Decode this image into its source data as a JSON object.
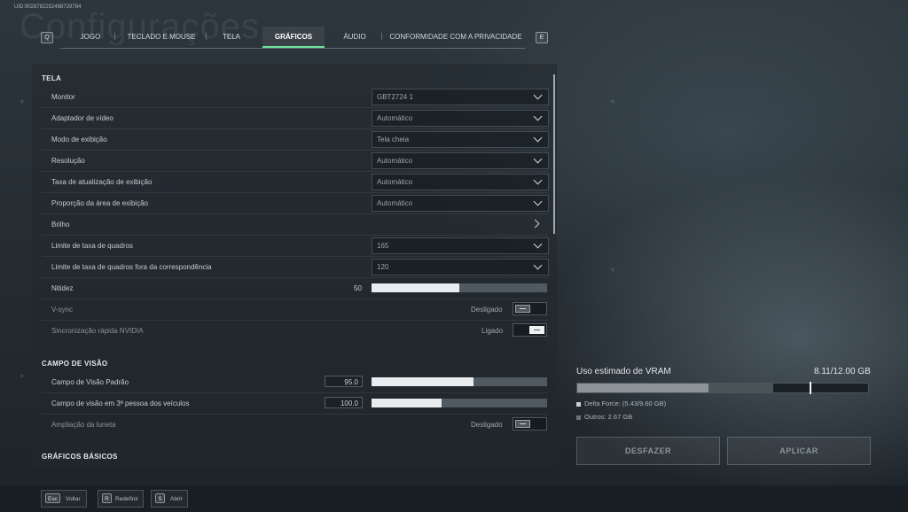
{
  "uid": "UID:9028782252488729784",
  "background_title": "Configurações",
  "tabs": {
    "left_key": "Q",
    "right_key": "E",
    "items": [
      {
        "label": "JOGO"
      },
      {
        "label": "TECLADO E MOUSE"
      },
      {
        "label": "TELA"
      },
      {
        "label": "GRÁFICOS"
      },
      {
        "label": "ÁUDIO"
      },
      {
        "label": "CONFORMIDADE COM A PRIVACIDADE"
      }
    ],
    "active": "GRÁFICOS"
  },
  "sections": {
    "tela": {
      "title": "TELA",
      "monitor": {
        "label": "Monitor",
        "value": "GBT2724 1"
      },
      "video_adapter": {
        "label": "Adaptador de vídeo",
        "value": "Automático"
      },
      "display_mode": {
        "label": "Modo de exibição",
        "value": "Tela cheia"
      },
      "resolution": {
        "label": "Resolução",
        "value": "Automático"
      },
      "refresh_rate": {
        "label": "Taxa de atualização de exibição",
        "value": "Automático"
      },
      "aspect_ratio": {
        "label": "Proporção da área de exibição",
        "value": "Automático"
      },
      "brightness": {
        "label": "Brilho"
      },
      "fps_limit": {
        "label": "Limite de taxa de quadros",
        "value": "165"
      },
      "fps_limit_unfocused": {
        "label": "Limite de taxa de quadros fora da correspondência",
        "value": "120"
      },
      "sharpness": {
        "label": "Nitidez",
        "value": "50",
        "level_percent": 50
      },
      "vsync": {
        "label": "V-sync",
        "state": "Desligado",
        "on": false
      },
      "nvidia_fast_sync": {
        "label": "Sincronização rápida NVIDIA",
        "state": "Ligado",
        "on": true
      }
    },
    "fov": {
      "title": "CAMPO DE VISÃO",
      "default_fov": {
        "label": "Campo de Visão Padrão",
        "value": "95.0",
        "level_percent": 58
      },
      "vehicle_fov": {
        "label": "Campo de visão em 3ª pessoa dos veículos",
        "value": "100.0",
        "level_percent": 40
      },
      "scope_zoom": {
        "label": "Ampliação da luneta",
        "state": "Desligado",
        "on": false
      }
    },
    "basic": {
      "title": "GRÁFICOS BÁSICOS"
    }
  },
  "vram": {
    "title": "Uso estimado de VRAM",
    "value": "8.11/12.00 GB",
    "delta_force_fraction": 0.4525,
    "others_fraction": 0.2225,
    "max_fraction": 0.8,
    "legend_delta": "Delta Force: (5.43/9.60 GB)",
    "legend_others": "Outros: 2.67 GB",
    "color_delta": "#c9cfd3",
    "color_others": "#6b747a"
  },
  "actions": {
    "undo": "DESFAZER",
    "apply": "APLICAR"
  },
  "footer": {
    "back_key": "Esc",
    "back_label": "Voltar",
    "reset_key": "R",
    "reset_label": "Redefinir",
    "open_key": "S",
    "open_label": "Abrir"
  }
}
